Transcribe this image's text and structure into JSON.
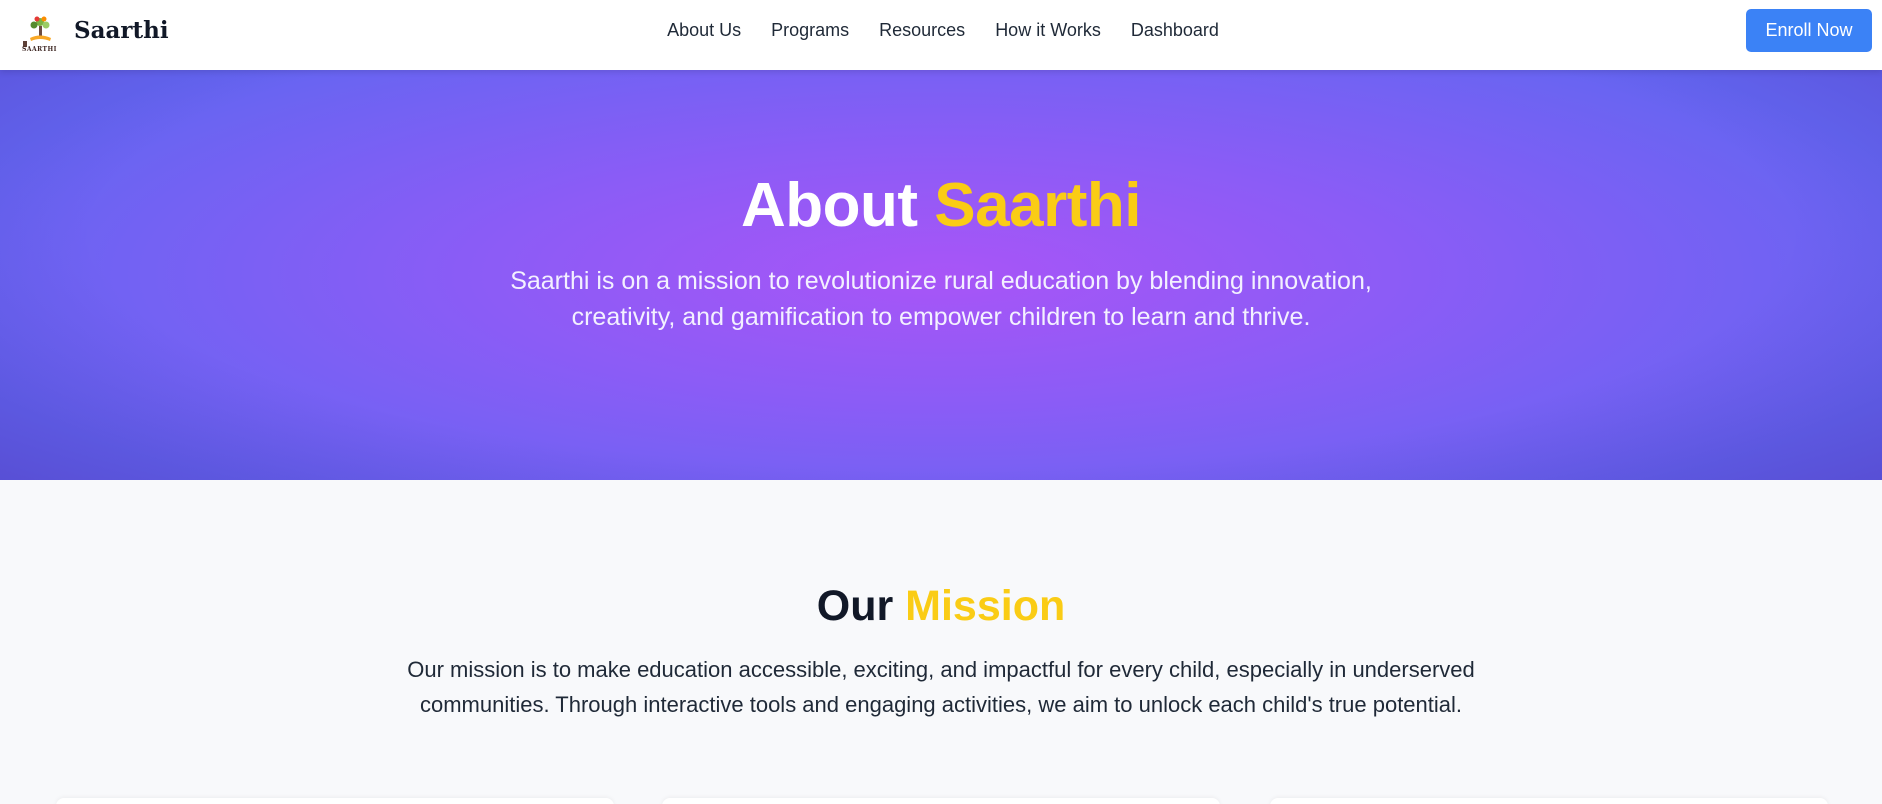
{
  "navbar": {
    "brand_name": "Saarthi",
    "logo_caption": "SAARTHI",
    "links": [
      "About Us",
      "Programs",
      "Resources",
      "How it Works",
      "Dashboard"
    ],
    "cta_label": "Enroll Now",
    "cta_color": "#3b82f6"
  },
  "hero": {
    "title_prefix": "About",
    "title_accent": "Saarthi",
    "description": "Saarthi is on a mission to revolutionize rural education by blending innovation, creativity, and gamification to empower children to learn and thrive.",
    "gradient_colors": [
      "#6366f1",
      "#a855f7"
    ],
    "accent_color": "#facc15"
  },
  "mission": {
    "title_prefix": "Our",
    "title_accent": "Mission",
    "description": "Our mission is to make education accessible, exciting, and impactful for every child, especially in underserved communities. Through interactive tools and engaging activities, we aim to unlock each child's true potential."
  }
}
